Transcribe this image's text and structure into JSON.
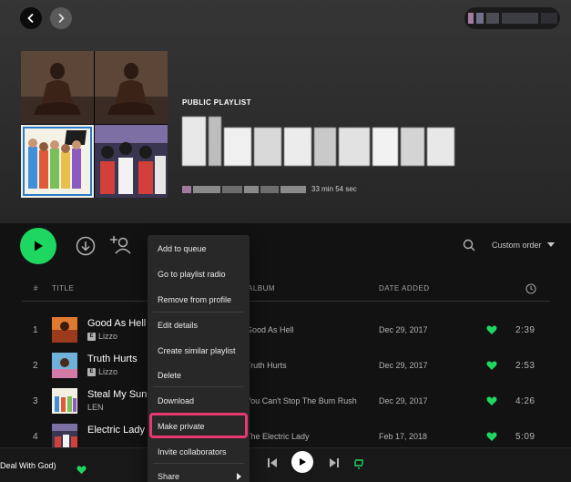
{
  "header": {
    "playlist_type": "PUBLIC PLAYLIST",
    "duration": "33 min 54 sec"
  },
  "controls": {
    "sort_label": "Custom order"
  },
  "table": {
    "col_num": "#",
    "col_title": "TITLE",
    "col_album": "ALBUM",
    "col_date": "DATE ADDED",
    "rows": [
      {
        "num": "1",
        "title": "Good As Hell",
        "artist": "Lizzo",
        "explicit": "E",
        "album": "Good As Hell",
        "date": "Dec 29, 2017",
        "duration": "2:39"
      },
      {
        "num": "2",
        "title": "Truth Hurts",
        "artist": "Lizzo",
        "explicit": "E",
        "album": "Truth Hurts",
        "date": "Dec 29, 2017",
        "duration": "2:53"
      },
      {
        "num": "3",
        "title": "Steal My Sun",
        "artist": "LEN",
        "album": "You Can't Stop The Bum Rush",
        "date": "Dec 29, 2017",
        "duration": "4:26"
      },
      {
        "num": "4",
        "title": "Electric Lady",
        "artist": "",
        "album": "The Electric Lady",
        "date": "Feb 17, 2018",
        "duration": "5:09"
      }
    ]
  },
  "context_menu": {
    "items": [
      "Add to queue",
      "Go to playlist radio",
      "Remove from profile",
      "Edit details",
      "Create similar playlist",
      "Delete",
      "Download",
      "Make private",
      "Invite collaborators",
      "Share"
    ]
  },
  "player": {
    "now_playing": "Deal With God)"
  },
  "colors": {
    "accent": "#1ed760",
    "highlight": "#e8386f",
    "background": "#121212",
    "menu": "#282828"
  }
}
